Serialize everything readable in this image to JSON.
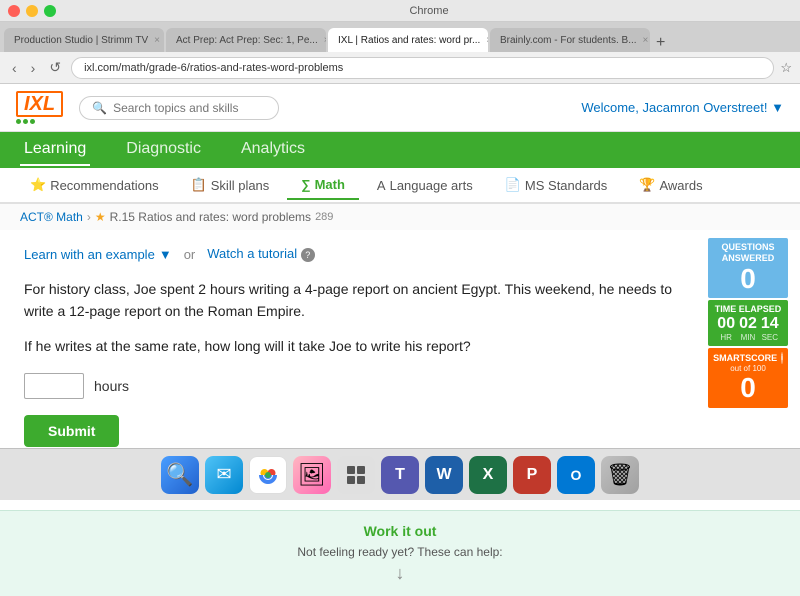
{
  "browser": {
    "tabs": [
      {
        "label": "Production Studio | Strimm TV",
        "active": false
      },
      {
        "label": "Act Prep: Act Prep: Sec: 1, Pe...",
        "active": false
      },
      {
        "label": "IXL | Ratios and rates: word pr...",
        "active": true
      },
      {
        "label": "Brainly.com - For students. B...",
        "active": false
      }
    ],
    "address": "ixl.com/math/grade-6/ratios-and-rates-word-problems",
    "nav_back": "‹",
    "nav_forward": "›",
    "nav_refresh": "↺"
  },
  "header": {
    "logo": "IXL",
    "search_placeholder": "Search topics and skills",
    "welcome": "Welcome, Jacamron Overstreet!",
    "welcome_icon": "▼"
  },
  "nav": {
    "items": [
      {
        "label": "Learning",
        "active": true
      },
      {
        "label": "Diagnostic",
        "active": false
      },
      {
        "label": "Analytics",
        "active": false
      }
    ]
  },
  "sub_nav": {
    "items": [
      {
        "label": "Recommendations",
        "icon": "★",
        "active": false
      },
      {
        "label": "Skill plans",
        "icon": "📋",
        "active": false
      },
      {
        "label": "Math",
        "icon": "∑",
        "active": true
      },
      {
        "label": "Language arts",
        "icon": "A",
        "active": false
      },
      {
        "label": "MS Standards",
        "icon": "📄",
        "active": false
      },
      {
        "label": "Awards",
        "icon": "🏆",
        "active": false
      }
    ]
  },
  "breadcrumb": {
    "items": [
      "ACT® Math",
      "R.15 Ratios and rates: word problems"
    ],
    "number": "289"
  },
  "action_bar": {
    "learn_label": "Learn with an example",
    "learn_icon": "▼",
    "or": "or",
    "tutorial_label": "Watch a tutorial",
    "tutorial_icon": "?"
  },
  "question": {
    "part1": "For history class, Joe spent 2 hours writing a 4-page report on ancient Egypt. This weekend, he needs to write a 12-page report on the Roman Empire.",
    "part2": "If he writes at the same rate, how long will it take Joe to write his report?",
    "answer_placeholder": "",
    "answer_unit": "hours",
    "submit_label": "Submit"
  },
  "stats": {
    "questions_answered_label": "Questions answered",
    "questions_value": "0",
    "time_elapsed_label": "Time elapsed",
    "time_hr": "00",
    "time_min": "02",
    "time_sec": "14",
    "hr_label": "HR",
    "min_label": "MIN",
    "sec_label": "SEC",
    "smartscore_label": "SmartScore",
    "smartscore_sub": "out of 100",
    "smartscore_value": "0",
    "info_icon": "i"
  },
  "work_it_out": {
    "link_label": "Work it out",
    "subtext": "Not feeling ready yet? These can help:"
  },
  "dock": {
    "apps": [
      {
        "name": "finder",
        "icon": "🔍",
        "label": "finder-icon"
      },
      {
        "name": "mail",
        "icon": "✉",
        "label": "mail-icon"
      },
      {
        "name": "chrome",
        "icon": "⊙",
        "label": "chrome-icon"
      },
      {
        "name": "photos",
        "icon": "🖼",
        "label": "photos-icon"
      },
      {
        "name": "grid",
        "icon": "⊞",
        "label": "grid-icon"
      },
      {
        "name": "teams",
        "icon": "T",
        "label": "teams-icon"
      },
      {
        "name": "word",
        "icon": "W",
        "label": "word-icon"
      },
      {
        "name": "excel",
        "icon": "X",
        "label": "excel-icon"
      },
      {
        "name": "powerpoint",
        "icon": "P",
        "label": "powerpoint-icon"
      },
      {
        "name": "outlook",
        "icon": "O",
        "label": "outlook-icon"
      },
      {
        "name": "trash",
        "icon": "🗑",
        "label": "trash-icon"
      }
    ]
  }
}
